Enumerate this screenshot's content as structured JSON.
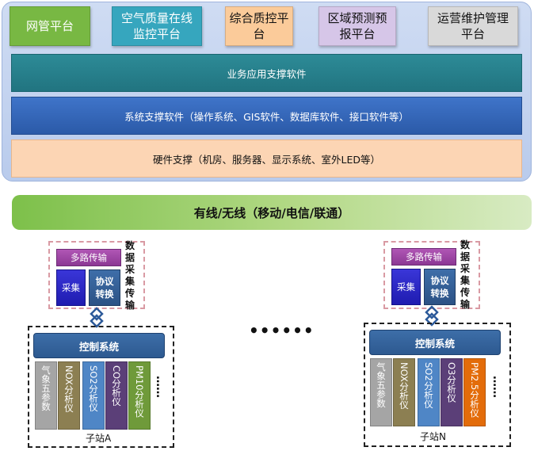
{
  "platforms": [
    {
      "key": "wg",
      "label": "网管平台",
      "bg": "#78b843"
    },
    {
      "key": "kq",
      "label": "空气质量在线监控平台",
      "bg": "#36a6be"
    },
    {
      "key": "zh",
      "label": "综合质控平台",
      "bg": "#fbcb9a"
    },
    {
      "key": "qy",
      "label": "区域预测预报平台",
      "bg": "#d6c6e8"
    },
    {
      "key": "yy",
      "label": "运营维护管理平台",
      "bg": "#d9d9d9"
    }
  ],
  "layers": {
    "app": "业务应用支撑软件",
    "system": "系统支撑软件（操作系统、GIS软件、数据库软件、接口软件等）",
    "hardware": "硬件支撑（机房、服务器、显示系统、室外LED等）"
  },
  "network": "有线/无线（移动/电信/联通）",
  "acquisition": {
    "mux": "多路传输",
    "collect": "采集",
    "protocol": "协议转换",
    "side_label": "数据采集传输"
  },
  "middle_dots": "••••••",
  "stations": [
    {
      "name": "子站A",
      "control": "控制系统",
      "instruments": [
        {
          "label": "气象五参数",
          "color": "#a5a5a5"
        },
        {
          "label": "NOX分析仪",
          "color": "#8c7f52"
        },
        {
          "label": "SO2分析仪",
          "color": "#4f86c6"
        },
        {
          "label": "CO分析仪",
          "color": "#5b3f78"
        },
        {
          "label": "PM10分析仪",
          "color": "#6f9a3a"
        }
      ],
      "more": "……"
    },
    {
      "name": "子站N",
      "control": "控制系统",
      "instruments": [
        {
          "label": "气象五参数",
          "color": "#a5a5a5"
        },
        {
          "label": "NOX分析仪",
          "color": "#8c7f52"
        },
        {
          "label": "SO2分析仪",
          "color": "#4f86c6"
        },
        {
          "label": "O3分析仪",
          "color": "#5b3f78"
        },
        {
          "label": "PM2.5分析仪",
          "color": "#e36c0a"
        }
      ],
      "more": "……"
    }
  ]
}
